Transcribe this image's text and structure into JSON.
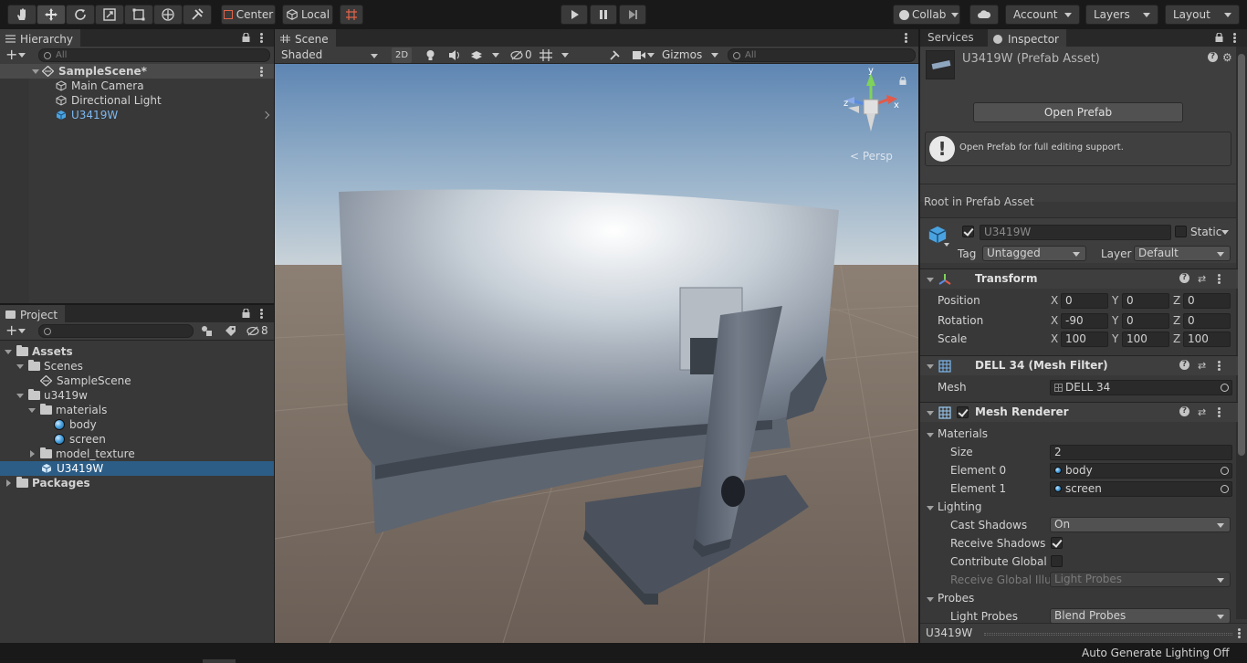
{
  "toolbar": {
    "center": "Center",
    "local": "Local",
    "collab": "Collab",
    "account": "Account",
    "layers": "Layers",
    "layout": "Layout"
  },
  "hierarchy": {
    "tab": "Hierarchy",
    "search_placeholder": "All",
    "scene_name": "SampleScene*",
    "items": [
      "Main Camera",
      "Directional Light",
      "U3419W"
    ]
  },
  "project": {
    "tab": "Project",
    "hidden_count": "8",
    "tree": {
      "assets": "Assets",
      "scenes": "Scenes",
      "sample_scene": "SampleScene",
      "u3419w_folder": "u3419w",
      "materials": "materials",
      "body": "body",
      "screen": "screen",
      "model_texture": "model_texture",
      "u3419w_asset": "U3419W",
      "packages": "Packages"
    }
  },
  "scene": {
    "tab": "Scene",
    "shading": "Shaded",
    "mode_2d": "2D",
    "hidden_count": "0",
    "gizmos": "Gizmos",
    "search_placeholder": "All",
    "persp": "< Persp",
    "gizmo_axes": {
      "y": "y",
      "z": "z",
      "x": "x"
    }
  },
  "inspector": {
    "tab_services": "Services",
    "tab_inspector": "Inspector",
    "asset_title": "U3419W (Prefab Asset)",
    "open_prefab_btn": "Open Prefab",
    "info_text": "Open Prefab for full editing support.",
    "root_label": "Root in Prefab Asset",
    "object_name": "U3419W",
    "static_label": "Static",
    "tag_label": "Tag",
    "tag_value": "Untagged",
    "layer_label": "Layer",
    "layer_value": "Default",
    "transform": {
      "title": "Transform",
      "position_label": "Position",
      "rotation_label": "Rotation",
      "scale_label": "Scale",
      "axis_x": "X",
      "axis_y": "Y",
      "axis_z": "Z",
      "position": [
        "0",
        "0",
        "0"
      ],
      "rotation": [
        "-90",
        "0",
        "0"
      ],
      "scale": [
        "100",
        "100",
        "100"
      ]
    },
    "mesh_filter": {
      "title": "DELL 34 (Mesh Filter)",
      "mesh_label": "Mesh",
      "mesh_value": "DELL 34"
    },
    "mesh_renderer": {
      "title": "Mesh Renderer",
      "materials_label": "Materials",
      "size_label": "Size",
      "size_value": "2",
      "element0_label": "Element 0",
      "element0_value": "body",
      "element1_label": "Element 1",
      "element1_value": "screen",
      "lighting_label": "Lighting",
      "cast_shadows_label": "Cast Shadows",
      "cast_shadows_value": "On",
      "receive_shadows_label": "Receive Shadows",
      "contribute_gi_label": "Contribute Global Il",
      "receive_gi_label": "Receive Global Illu",
      "receive_gi_value": "Light Probes",
      "probes_label": "Probes",
      "light_probes_label": "Light Probes",
      "light_probes_value": "Blend Probes"
    },
    "footer": "U3419W"
  },
  "status": {
    "auto_lighting": "Auto Generate Lighting Off"
  },
  "colors": {
    "selection": "#2c5d87",
    "panel": "#383838",
    "toolbar": "#191919",
    "accent_blue": "#4aa3e0"
  }
}
